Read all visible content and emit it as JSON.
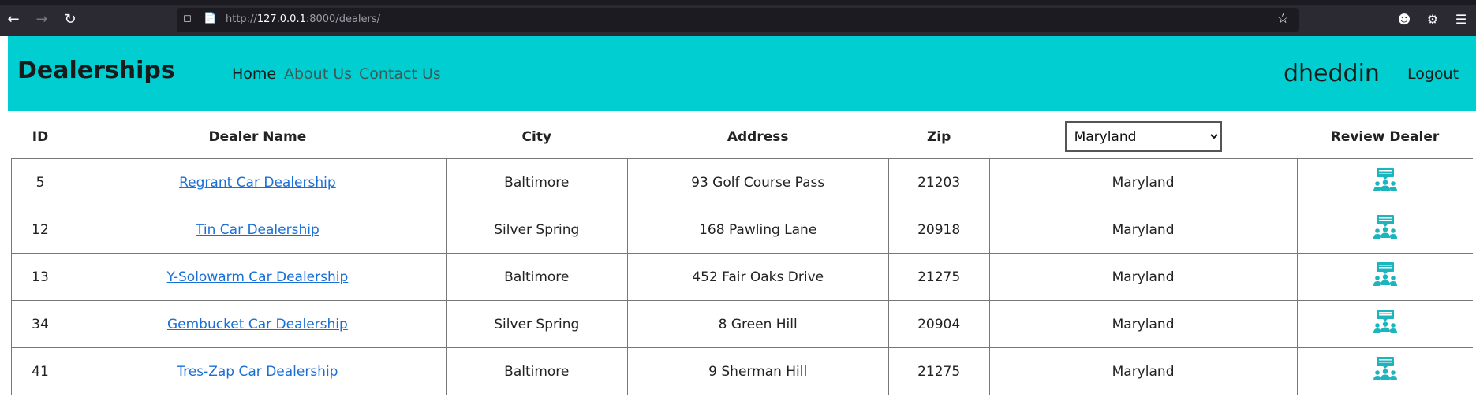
{
  "browser": {
    "url_prefix": "http://",
    "url_host": "127.0.0.1",
    "url_rest": ":8000/dealers/"
  },
  "nav": {
    "brand": "Dealerships",
    "links": [
      "Home",
      "About Us",
      "Contact Us"
    ],
    "username": "dheddin",
    "logout": "Logout"
  },
  "table": {
    "headers": {
      "id": "ID",
      "dealer_name": "Dealer Name",
      "city": "City",
      "address": "Address",
      "zip": "Zip",
      "review": "Review Dealer"
    },
    "state_filter": {
      "selected": "Maryland"
    },
    "rows": [
      {
        "id": "5",
        "name": "Regrant Car Dealership",
        "city": "Baltimore",
        "address": "93 Golf Course Pass",
        "zip": "21203",
        "state": "Maryland"
      },
      {
        "id": "12",
        "name": "Tin Car Dealership",
        "city": "Silver Spring",
        "address": "168 Pawling Lane",
        "zip": "20918",
        "state": "Maryland"
      },
      {
        "id": "13",
        "name": "Y-Solowarm Car Dealership",
        "city": "Baltimore",
        "address": "452 Fair Oaks Drive",
        "zip": "21275",
        "state": "Maryland"
      },
      {
        "id": "34",
        "name": "Gembucket Car Dealership",
        "city": "Silver Spring",
        "address": "8 Green Hill",
        "zip": "20904",
        "state": "Maryland"
      },
      {
        "id": "41",
        "name": "Tres-Zap Car Dealership",
        "city": "Baltimore",
        "address": "9 Sherman Hill",
        "zip": "21275",
        "state": "Maryland"
      }
    ]
  },
  "colors": {
    "navbar_bg": "#00ced1",
    "link": "#1a6fd6",
    "review_icon": "#1cb5bd"
  }
}
